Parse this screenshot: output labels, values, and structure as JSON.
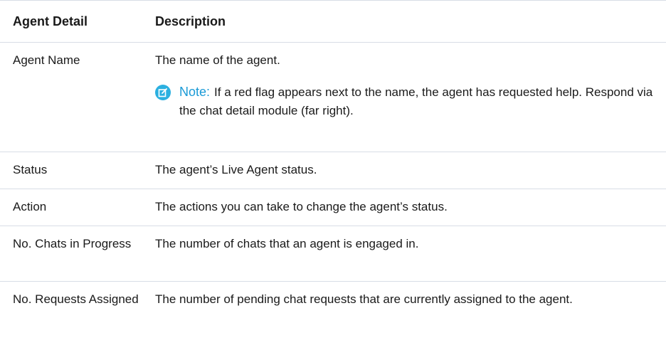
{
  "table": {
    "headers": [
      "Agent Detail",
      "Description"
    ],
    "rows": [
      {
        "detail": "Agent Name",
        "description": "The name of the agent.",
        "note": {
          "label": "Note:",
          "text": "If a red flag appears next to the name, the agent has requested help. Respond via the chat detail module (far right)."
        }
      },
      {
        "detail": "Status",
        "description": "The agent’s Live Agent status."
      },
      {
        "detail": "Action",
        "description": "The actions you can take to change the agent’s status."
      },
      {
        "detail": "No. Chats in Progress",
        "description": "The number of chats that an agent is engaged in."
      },
      {
        "detail": "No. Requests Assigned",
        "description": "The number of pending chat requests that are currently assigned to the agent."
      }
    ]
  },
  "colors": {
    "note_accent": "#1a9ad6",
    "icon_bg": "#2bb0e0",
    "border": "#d8dde6"
  },
  "icons": {
    "note": "edit-note-icon"
  }
}
